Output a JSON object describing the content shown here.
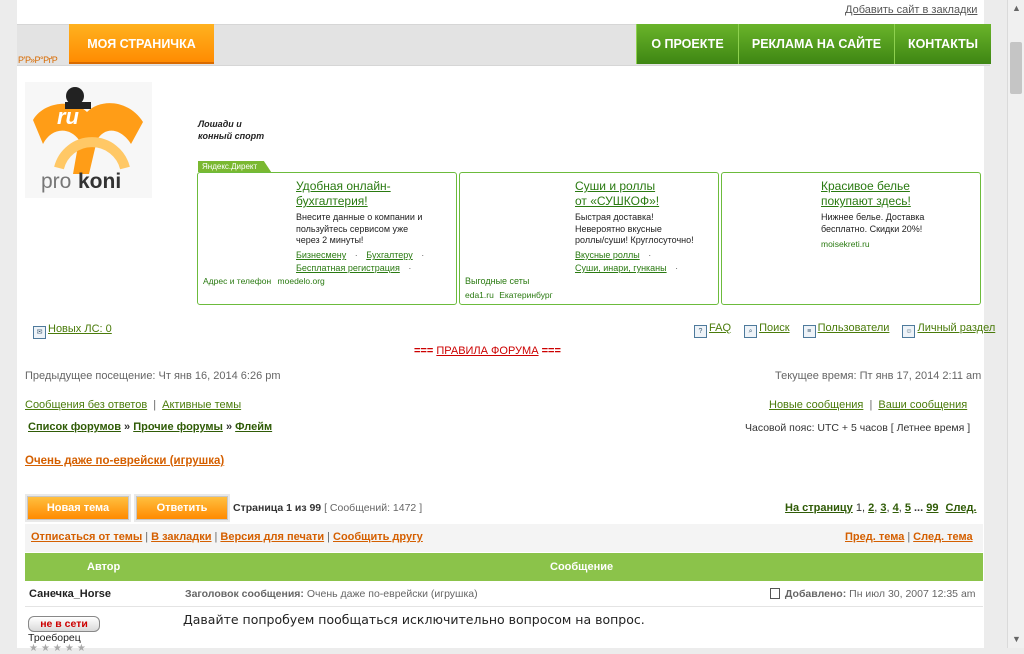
{
  "top": {
    "bookmark_link": "Добавить сайт в закладки"
  },
  "nav": {
    "lang_glyph": "Р’Р»Р°РґР",
    "my_page": "МОЯ СТРАНИЧКА",
    "about": "О ПРОЕКТЕ",
    "ads": "РЕКЛАМА НА САЙТЕ",
    "contacts": "КОНТАКТЫ"
  },
  "header": {
    "logo_text_pro": "pro",
    "logo_text_koni": "koni",
    "logo_ru": "ru",
    "tagline_line1": "Лошади и",
    "tagline_line2": "конный спорт"
  },
  "yandex": {
    "label": "Яндекс.Директ",
    "ads": [
      {
        "title_l1": "Удобная онлайн-",
        "title_l2": "бухгалтерия!",
        "text_l1": "Внесите данные о компании и",
        "text_l2": "пользуйтесь сервисом уже",
        "text_l3": "через 2 минуты!",
        "link1": "Бизнесмену",
        "link2": "Бухгалтеру",
        "link3": "Бесплатная регистрация",
        "foot1": "Адрес и телефон",
        "foot2": "moedelo.org"
      },
      {
        "title_l1": "Суши и роллы",
        "title_l2": "от «СУШКОФ»!",
        "text_l1": "Быстрая доставка!",
        "text_l2": "Невероятно вкусные",
        "text_l3": "роллы/суши! Круглосуточно!",
        "link1": "Вкусные роллы",
        "link2": "Суши, инари, гунканы",
        "extra": "Выгодные сеты",
        "foot1": "eda1.ru",
        "foot2": "Екатеринбург"
      },
      {
        "title_l1": "Красивое белье",
        "title_l2": "покупают здесь!",
        "text_l1": "Нижнее белье. Доставка",
        "text_l2": "бесплатно. Скидки 20%!",
        "foot1": "moisekreti.ru"
      }
    ]
  },
  "forum": {
    "new_pm": "Новых ЛС: 0",
    "faq": "FAQ",
    "search": "Поиск",
    "users": "Пользователи",
    "profile": "Личный раздел",
    "rules_prefix": "===",
    "rules_link": "ПРАВИЛА ФОРУМА",
    "rules_suffix": "===",
    "last_visit": "Предыдущее посещение: Чт янв 16, 2014 6:26 pm",
    "current_time": "Текущее время: Пт янв 17, 2014 2:11 am",
    "unanswered": "Сообщения без ответов",
    "active": "Активные темы",
    "new_posts": "Новые сообщения",
    "your_posts": "Ваши сообщения",
    "crumb1": "Список форумов",
    "crumb2": "Прочие форумы",
    "crumb3": "Флейм",
    "timezone": "Часовой пояс: UTC + 5 часов [ Летнее время ]"
  },
  "topic": {
    "title": "Очень даже по-еврейски (игрушка)",
    "new_topic_btn": "Новая тема",
    "reply_btn": "Ответить",
    "page_info_bold": "Страница 1 из 99",
    "post_count": "[ Сообщений: 1472 ]",
    "to_page": "На страницу",
    "pages": [
      "1",
      "2",
      "3",
      "4",
      "5"
    ],
    "ellipsis": "...",
    "last_page": "99",
    "next": "След."
  },
  "tools": {
    "unsubscribe": "Отписаться от темы",
    "bookmarks": "В закладки",
    "print": "Версия для печати",
    "tell_friend": "Сообщить другу",
    "prev_topic": "Пред. тема",
    "next_topic": "След. тема"
  },
  "table": {
    "col_author": "Автор",
    "col_message": "Сообщение",
    "author": "Санечка_Horse",
    "subject_label": "Заголовок сообщения:",
    "subject": "Очень даже по-еврейски (игрушка)",
    "added_label": "Добавлено:",
    "added": "Пн июл 30, 2007 12:35 am",
    "offline_badge": "не в сети",
    "rank": "Троеборец",
    "post_text": "Давайте попробуем пообщаться исключительно вопросом на вопрос."
  },
  "colors": {
    "accent_orange": "#ff8a00",
    "accent_green": "#6ab42a",
    "link_green": "#4a7b0a"
  }
}
